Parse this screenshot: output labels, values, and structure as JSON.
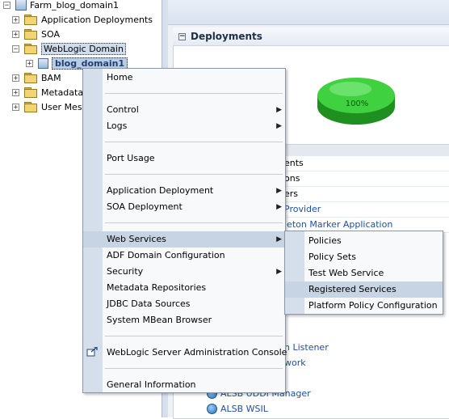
{
  "tree": {
    "root": {
      "label": "Farm_blog_domain1"
    },
    "items": [
      {
        "label": "Application Deployments",
        "toggle": "+"
      },
      {
        "label": "SOA",
        "toggle": "+"
      },
      {
        "label": "WebLogic Domain",
        "toggle": "−"
      },
      {
        "label": "blog_domain1",
        "toggle": "+"
      },
      {
        "label": "BAM",
        "toggle": "+"
      },
      {
        "label": "Metadata R",
        "toggle": "+"
      },
      {
        "label": "User Messa",
        "toggle": "+"
      }
    ]
  },
  "deployments": {
    "title": "Deployments",
    "pie": {
      "percent_label": "100%",
      "color": "#2fc42f"
    },
    "rows": [
      "ents",
      "ons",
      "ers",
      "Provider",
      "leton Marker Application"
    ],
    "bottom_rows": [
      "n Listener",
      "work",
      "ALSB UDDI Manager",
      "ALSB WSIL"
    ]
  },
  "context_menu": {
    "items": [
      {
        "label": "Home"
      },
      {
        "label": "Control"
      },
      {
        "label": "Logs"
      },
      {
        "label": "Port Usage"
      },
      {
        "label": "Application Deployment"
      },
      {
        "label": "SOA Deployment"
      },
      {
        "label": "Web Services"
      },
      {
        "label": "ADF Domain Configuration"
      },
      {
        "label": "Security"
      },
      {
        "label": "Metadata Repositories"
      },
      {
        "label": "JDBC Data Sources"
      },
      {
        "label": "System MBean Browser"
      },
      {
        "label": "WebLogic Server Administration Console"
      },
      {
        "label": "General Information"
      }
    ],
    "submenu_arrow": "▶"
  },
  "web_services_submenu": {
    "items": [
      {
        "label": "Policies"
      },
      {
        "label": "Policy Sets"
      },
      {
        "label": "Test Web Service"
      },
      {
        "label": "Registered Services"
      },
      {
        "label": "Platform Policy Configuration"
      }
    ]
  },
  "colors": {
    "highlight": "#c7d4e3",
    "link": "#1e4fa3",
    "accent": "#d5dfeb"
  }
}
